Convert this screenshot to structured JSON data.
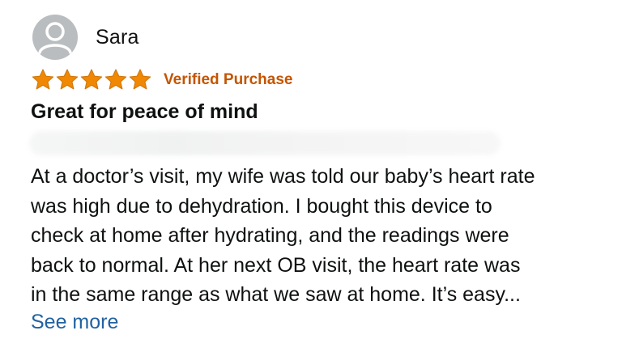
{
  "review": {
    "reviewer_name": "Sara",
    "avatar_icon": "person-icon",
    "rating": 5,
    "rating_max": 5,
    "star_color": "#f08804",
    "verified_label": "Verified Purchase",
    "verified_color": "#c45500",
    "title": "Great for peace of mind",
    "body_lines": [
      "At a doctor’s visit, my wife was told our baby’s heart rate",
      "was high due to dehydration. I bought this device to",
      "check at home after hydrating, and the readings were",
      "back to normal. At her next OB visit, the heart rate was",
      "in the same range as what we saw at home. It’s easy..."
    ],
    "see_more_label": "See more",
    "link_color": "#2162a1"
  }
}
